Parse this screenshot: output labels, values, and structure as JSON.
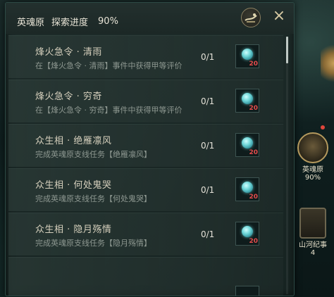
{
  "header": {
    "name": "英魂原",
    "progress_label": "探索进度",
    "progress_value": "90%"
  },
  "icons": {
    "brush": "brush-emblem-icon",
    "close": "×"
  },
  "tasks": [
    {
      "title": "烽火急令 · 清雨",
      "desc": "在【烽火急令 · 清雨】事件中获得甲等评价",
      "count": "0/1",
      "reward_qty": "20"
    },
    {
      "title": "烽火急令 · 穷奇",
      "desc": "在【烽火急令 · 穷奇】事件中获得甲等评价",
      "count": "0/1",
      "reward_qty": "20"
    },
    {
      "title": "众生相 · 绝雁凛风",
      "desc": "完成英魂原支线任务【绝雁凛风】",
      "count": "0/1",
      "reward_qty": "20"
    },
    {
      "title": "众生相 · 何处鬼哭",
      "desc": "完成英魂原支线任务【何处鬼哭】",
      "count": "0/1",
      "reward_qty": "20"
    },
    {
      "title": "众生相 · 隐月殇情",
      "desc": "完成英魂原支线任务【隐月殇情】",
      "count": "0/1",
      "reward_qty": "20"
    }
  ],
  "sidebar": {
    "region": {
      "label": "英魂原",
      "value": "90%"
    },
    "journal": {
      "label": "山河纪事",
      "value": "4"
    }
  },
  "colors": {
    "accent_gold": "#b59a5e",
    "reward_qty_red": "#e44c4c",
    "gem_cyan": "#6fd6d8"
  }
}
